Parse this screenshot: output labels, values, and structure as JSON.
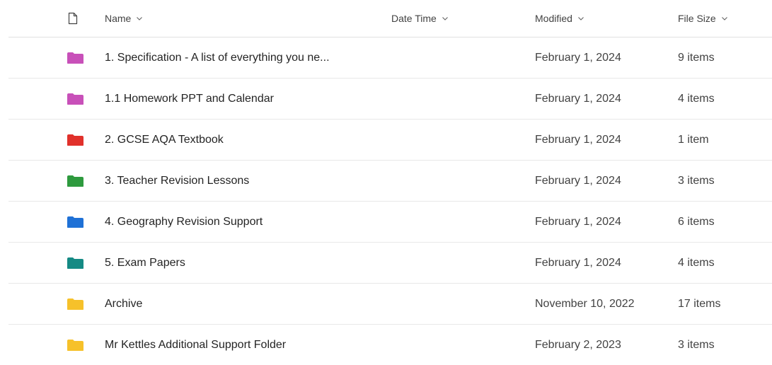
{
  "header": {
    "file_type_icon": "document-icon",
    "name": "Name",
    "date_time": "Date Time",
    "modified": "Modified",
    "file_size": "File Size"
  },
  "rows": [
    {
      "name": "1. Specification - A list of everything you ne...",
      "modified": "February 1, 2024",
      "size": "9 items",
      "folder_color": "#c850b9"
    },
    {
      "name": "1.1 Homework PPT and Calendar",
      "modified": "February 1, 2024",
      "size": "4 items",
      "folder_color": "#c850b9"
    },
    {
      "name": "2. GCSE AQA Textbook",
      "modified": "February 1, 2024",
      "size": "1 item",
      "folder_color": "#e0312b"
    },
    {
      "name": "3. Teacher Revision Lessons",
      "modified": "February 1, 2024",
      "size": "3 items",
      "folder_color": "#2e9a3e"
    },
    {
      "name": "4. Geography Revision Support",
      "modified": "February 1, 2024",
      "size": "6 items",
      "folder_color": "#2071d6"
    },
    {
      "name": "5. Exam Papers",
      "modified": "February 1, 2024",
      "size": "4 items",
      "folder_color": "#158a84"
    },
    {
      "name": "Archive",
      "modified": "November 10, 2022",
      "size": "17 items",
      "folder_color": "#f6c12a"
    },
    {
      "name": "Mr Kettles Additional Support Folder",
      "modified": "February 2, 2023",
      "size": "3 items",
      "folder_color": "#f6c12a"
    }
  ]
}
